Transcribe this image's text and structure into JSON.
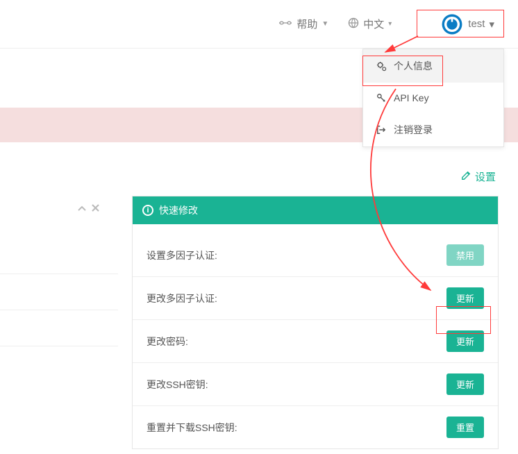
{
  "topnav": {
    "help": "帮助",
    "language": "中文",
    "username": "test"
  },
  "dropdown": {
    "profile": "个人信息",
    "api": "API Key",
    "logout": "注销登录"
  },
  "settings_link": "设置",
  "panel": {
    "title": "快速修改",
    "rows": [
      {
        "label": "设置多因子认证:",
        "btn": "禁用",
        "muted": true
      },
      {
        "label": "更改多因子认证:",
        "btn": "更新",
        "muted": false
      },
      {
        "label": "更改密码:",
        "btn": "更新",
        "muted": false
      },
      {
        "label": "更改SSH密钥:",
        "btn": "更新",
        "muted": false
      },
      {
        "label": "重置并下载SSH密钥:",
        "btn": "重置",
        "muted": false
      }
    ]
  }
}
